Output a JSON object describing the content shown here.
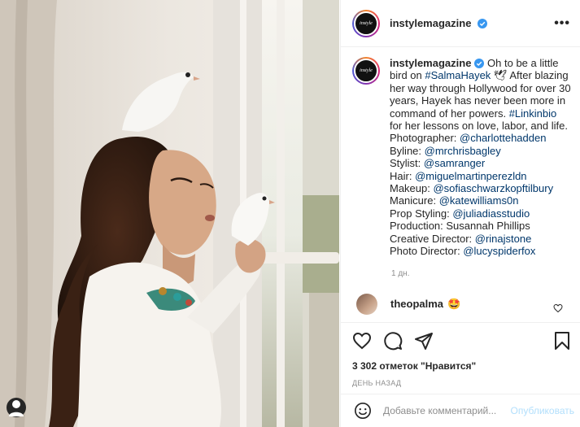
{
  "post": {
    "username": "instylemagazine",
    "avatar_text": "instyle",
    "more_label": "•••"
  },
  "caption": {
    "username": "instylemagazine",
    "line1": " Oh to be a little bird on ",
    "hashtag1": "#SalmaHayek",
    "line2": " 🕊 After blazing her way through Hollywood for over 30 years, Hayek has never been more in command of her powers. ",
    "hashtag2": "#Linkinbio",
    "line3": " for her lessons on love, labor, and life.",
    "credits": [
      {
        "label": "Photographer: ",
        "handle": "@charlottehadden"
      },
      {
        "label": "Byline: ",
        "handle": "@mrchrisbagley"
      },
      {
        "label": "Stylist: ",
        "handle": "@samranger"
      },
      {
        "label": "Hair: ",
        "handle": "@miguelmartinperezldn"
      },
      {
        "label": "Makeup: ",
        "handle": "@sofiaschwarzkopftilbury"
      },
      {
        "label": "Manicure: ",
        "handle": "@katewilliams0n"
      },
      {
        "label": "Prop Styling: ",
        "handle": "@juliadiasstudio"
      },
      {
        "label": "Production: Susannah Phillips",
        "handle": ""
      },
      {
        "label": "Creative Director: ",
        "handle": "@rinajstone"
      },
      {
        "label": "Photo Director: ",
        "handle": "@lucyspiderfox"
      }
    ],
    "time_ago": "1 дн."
  },
  "comment": {
    "username": "theopalma",
    "emoji": "🤩"
  },
  "engagement": {
    "likes": "3 302 отметок \"Нравится\"",
    "date": "ДЕНЬ НАЗАД"
  },
  "comment_box": {
    "placeholder": "Добавьте комментарий...",
    "publish_label": "Опубликовать"
  },
  "colors": {
    "link": "#00376b",
    "verified": "#3897f0",
    "publish_disabled": "#b2dffc"
  }
}
